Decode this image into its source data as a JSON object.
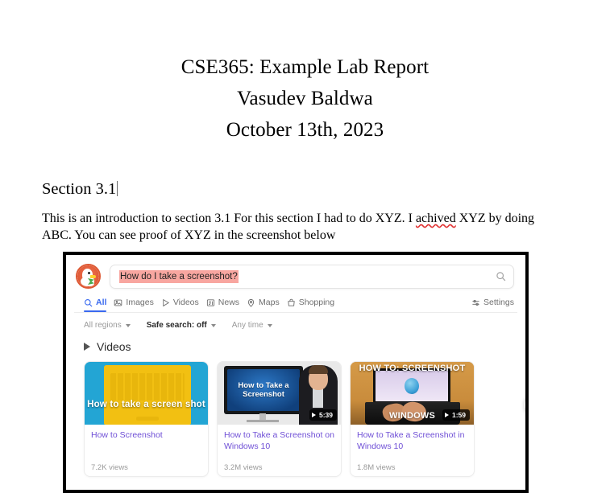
{
  "document": {
    "title_lines": [
      "CSE365: Example Lab Report",
      "Vasudev Baldwa",
      "October 13th, 2023"
    ],
    "section_heading": "Section 3.1",
    "paragraph": {
      "part1": "This is an introduction to section 3.1 For this section I had to do XYZ. I ",
      "misspelled_word": "achived",
      "part2": " XYZ by doing ABC. You can see proof of XYZ in the screenshot below"
    }
  },
  "figure": {
    "search": {
      "logo_name": "duckduckgo-logo",
      "query": "How do I take a screenshot?",
      "search_icon": "magnifier-icon",
      "selection_highlight_color": "#f8a6a0"
    },
    "nav_tabs": [
      {
        "label": "All",
        "icon": "search-icon",
        "active": true
      },
      {
        "label": "Images",
        "icon": "image-icon",
        "active": false
      },
      {
        "label": "Videos",
        "icon": "play-icon",
        "active": false
      },
      {
        "label": "News",
        "icon": "news-icon",
        "active": false
      },
      {
        "label": "Maps",
        "icon": "map-pin-icon",
        "active": false
      },
      {
        "label": "Shopping",
        "icon": "shopping-bag-icon",
        "active": false
      }
    ],
    "settings_tab": {
      "label": "Settings",
      "icon": "sliders-icon"
    },
    "filters": [
      {
        "label": "All regions",
        "bold": false
      },
      {
        "label": "Safe search: off",
        "bold": true
      },
      {
        "label": "Any time",
        "bold": false
      }
    ],
    "videos_section": {
      "heading": "Videos",
      "heading_icon": "play-icon",
      "next_button_icon": "chevron-right-icon",
      "cards": [
        {
          "thumb_overlay": "How to take a screen shot",
          "duration": "",
          "title": "How to Screenshot",
          "views": "7.2K views"
        },
        {
          "thumb_overlay": "How to Take a Screenshot",
          "duration": "5:39",
          "title": "How to Take a Screenshot on Windows 10",
          "views": "3.2M views"
        },
        {
          "thumb_overlay_top": "HOW TO: SCREENSHOT",
          "thumb_overlay_bottom": "WINDOWS",
          "duration": "1:59",
          "title": "How to Take a Screenshot in Windows 10",
          "views": "1.8M views"
        }
      ]
    },
    "colors": {
      "accent_blue": "#3969ef",
      "link_purple": "#6f4fd6",
      "ddg_orange": "#de5833"
    }
  }
}
